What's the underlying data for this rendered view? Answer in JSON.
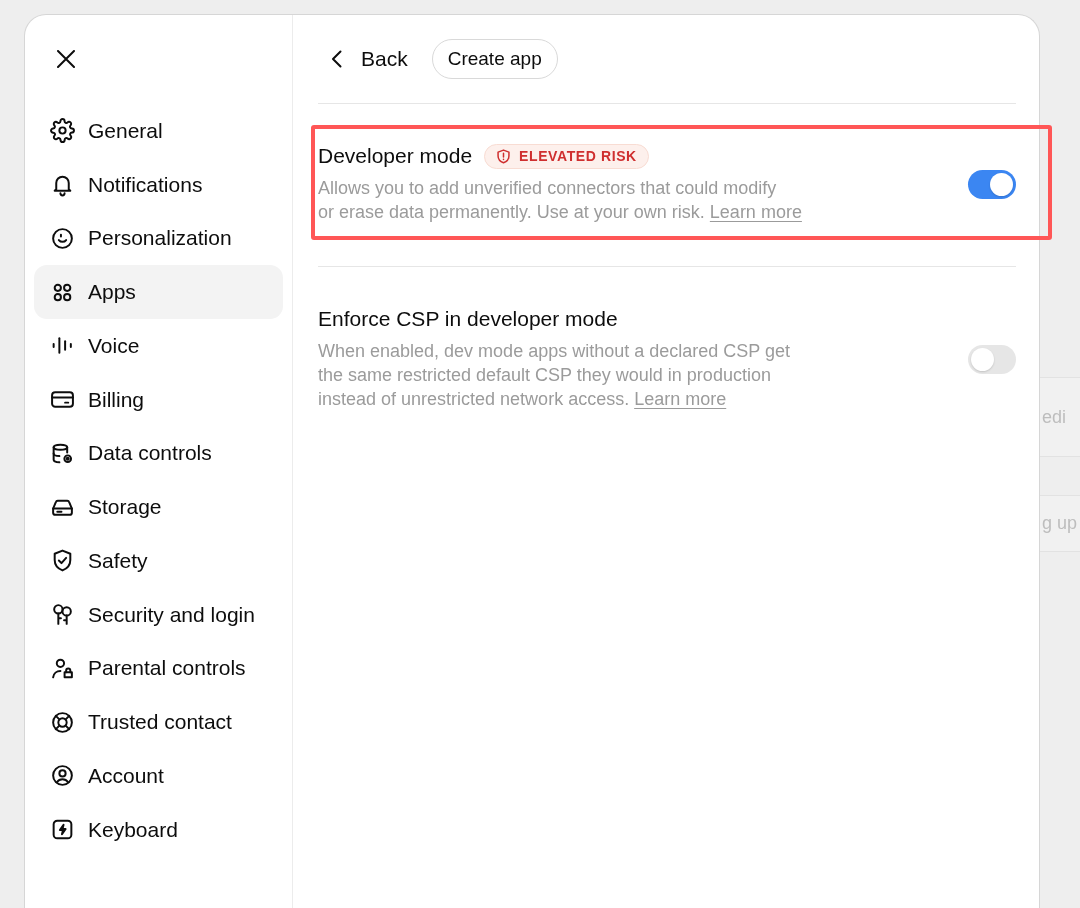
{
  "sidebar": {
    "items": [
      {
        "label": "General",
        "selected": false
      },
      {
        "label": "Notifications",
        "selected": false
      },
      {
        "label": "Personalization",
        "selected": false
      },
      {
        "label": "Apps",
        "selected": true
      },
      {
        "label": "Voice",
        "selected": false
      },
      {
        "label": "Billing",
        "selected": false
      },
      {
        "label": "Data controls",
        "selected": false
      },
      {
        "label": "Storage",
        "selected": false
      },
      {
        "label": "Safety",
        "selected": false
      },
      {
        "label": "Security and login",
        "selected": false
      },
      {
        "label": "Parental controls",
        "selected": false
      },
      {
        "label": "Trusted contact",
        "selected": false
      },
      {
        "label": "Account",
        "selected": false
      },
      {
        "label": "Keyboard",
        "selected": false
      }
    ]
  },
  "header": {
    "back": "Back",
    "create_button": "Create app"
  },
  "settings": [
    {
      "title": "Developer mode",
      "badge": "ELEVATED RISK",
      "description": "Allows you to add unverified connectors that could modify or erase data permanently. Use at your own risk.",
      "link": "Learn more",
      "on": true,
      "highlighted": true
    },
    {
      "title": "Enforce CSP in developer mode",
      "description": "When enabled, dev mode apps without a declared CSP get the same restricted default CSP they would in production instead of unrestricted network access.",
      "link": "Learn more",
      "on": false
    }
  ],
  "background_page": {
    "texts": [
      "edi",
      "g up"
    ]
  }
}
